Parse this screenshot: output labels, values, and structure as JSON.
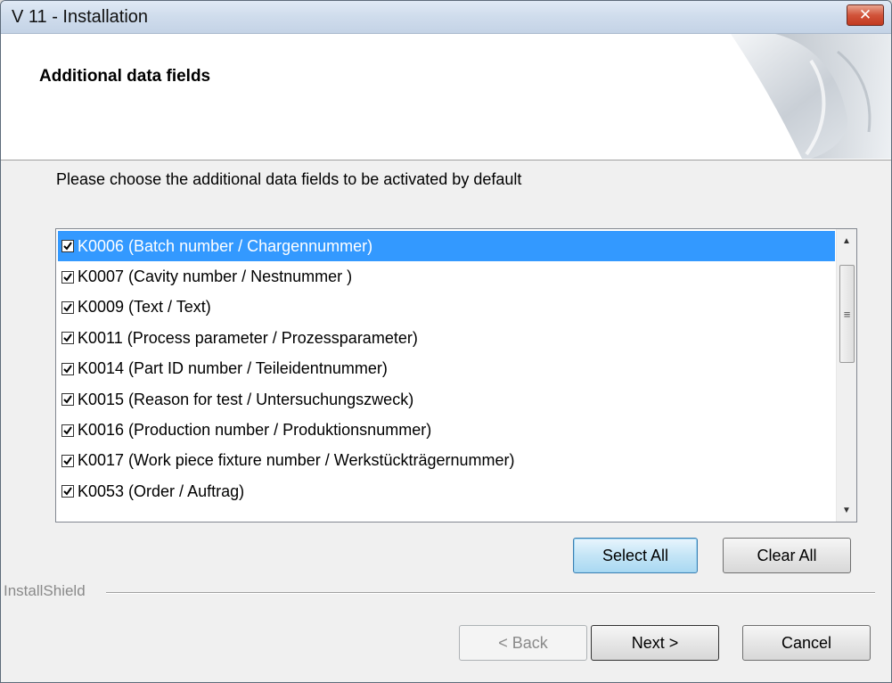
{
  "window": {
    "title": "V 11 - Installation",
    "close_glyph": "✕"
  },
  "header": {
    "title": "Additional data fields"
  },
  "instruction": "Please choose the additional data fields to be activated by default",
  "list": {
    "items": [
      {
        "label": "K0006 (Batch number / Chargennummer)",
        "checked": true,
        "selected": true
      },
      {
        "label": "K0007 (Cavity number / Nestnummer )",
        "checked": true,
        "selected": false
      },
      {
        "label": "K0009 (Text / Text)",
        "checked": true,
        "selected": false
      },
      {
        "label": "K0011 (Process parameter / Prozessparameter)",
        "checked": true,
        "selected": false
      },
      {
        "label": "K0014 (Part ID number / Teileidentnummer)",
        "checked": true,
        "selected": false
      },
      {
        "label": "K0015 (Reason for test / Untersuchungszweck)",
        "checked": true,
        "selected": false
      },
      {
        "label": "K0016 (Production number / Produktionsnummer)",
        "checked": true,
        "selected": false
      },
      {
        "label": "K0017 (Work piece fixture number / Werkstückträgernummer)",
        "checked": true,
        "selected": false
      },
      {
        "label": "K0053 (Order / Auftrag)",
        "checked": true,
        "selected": false
      }
    ]
  },
  "buttons": {
    "select_all": "Select All",
    "clear_all": "Clear All",
    "back": "< Back",
    "next": "Next >",
    "cancel": "Cancel"
  },
  "branding": "InstallShield",
  "colors": {
    "selection": "#3399ff",
    "close_button": "#c94a30"
  },
  "icons": {
    "close": "close-icon",
    "check": "checkmark-icon",
    "scroll_up": "scroll-up-arrow-icon",
    "scroll_down": "scroll-down-arrow-icon"
  }
}
